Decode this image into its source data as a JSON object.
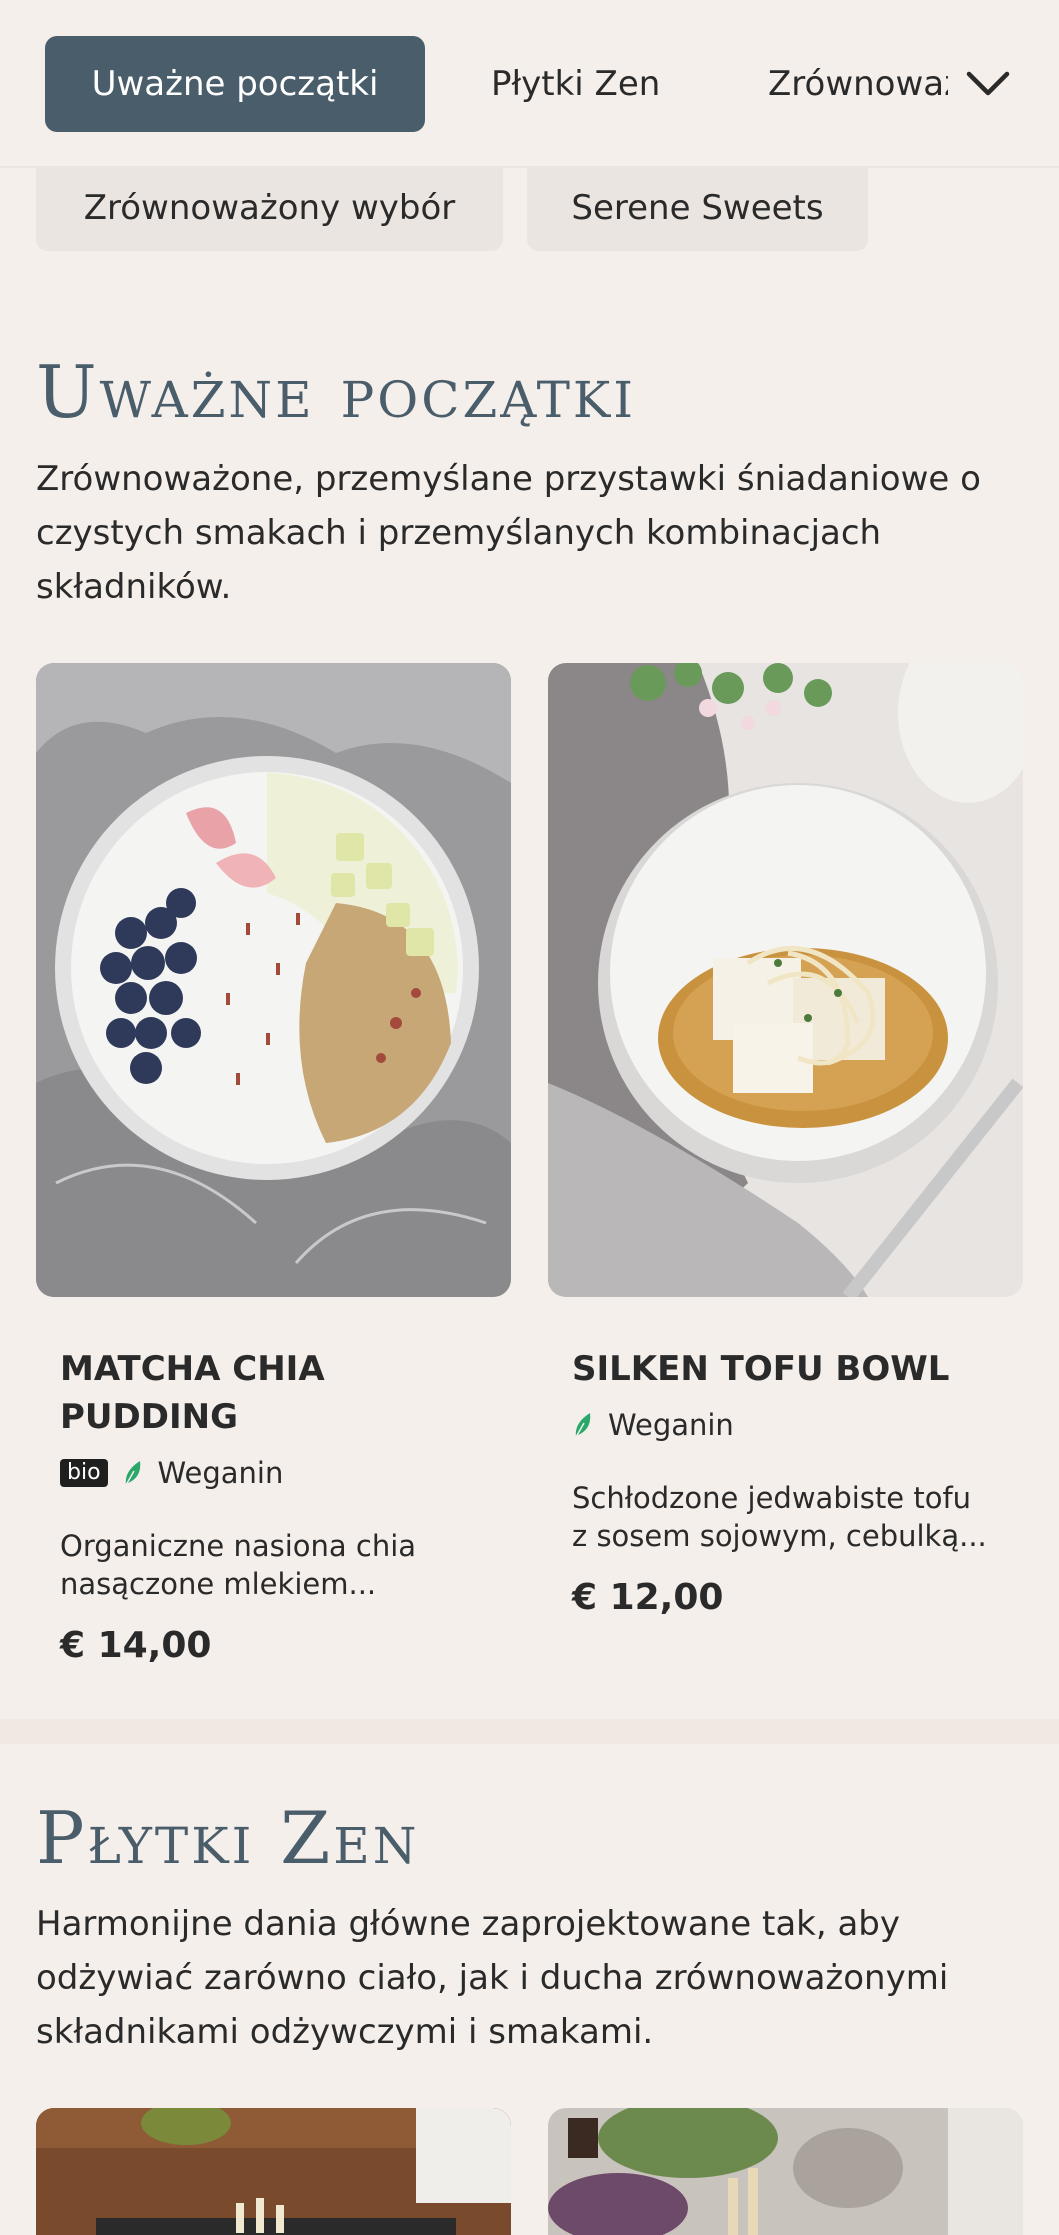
{
  "nav": {
    "tabs": [
      {
        "label": "Uważne początki",
        "active": true
      },
      {
        "label": "Płytki Zen",
        "active": false
      },
      {
        "label": "Zrównoważony wybór",
        "active": false
      }
    ],
    "chips": [
      {
        "label": "Zrównoważony wybór"
      },
      {
        "label": "Serene Sweets"
      }
    ],
    "expand_icon": "chevron-down-icon"
  },
  "sections": [
    {
      "title": "Uważne początki",
      "description": "Zrównoważone, przemyślane przystawki śniadaniowe o czystych smakach i przemyślanych kombinacjach składników.",
      "items": [
        {
          "name": "Matcha Chia Pudding",
          "bio": "bio",
          "diet": "Weganin",
          "description": "Organiczne nasiona chia nasączone mlekiem...",
          "price": "€ 14,00"
        },
        {
          "name": "Silken Tofu Bowl",
          "diet": "Weganin",
          "description": "Schłodzone jedwabiste tofu z sosem sojowym, cebulką...",
          "price": "€ 12,00"
        }
      ]
    },
    {
      "title": "Płytki Zen",
      "description": "Harmonijne dania główne zaprojektowane tak, aby odżywiać zarówno ciało, jak i ducha zrównoważonymi składnikami odżywczymi i smakami."
    }
  ],
  "colors": {
    "background": "#f5efeb",
    "accent": "#4a5d6b",
    "vegan_leaf": "#2aa86a"
  }
}
